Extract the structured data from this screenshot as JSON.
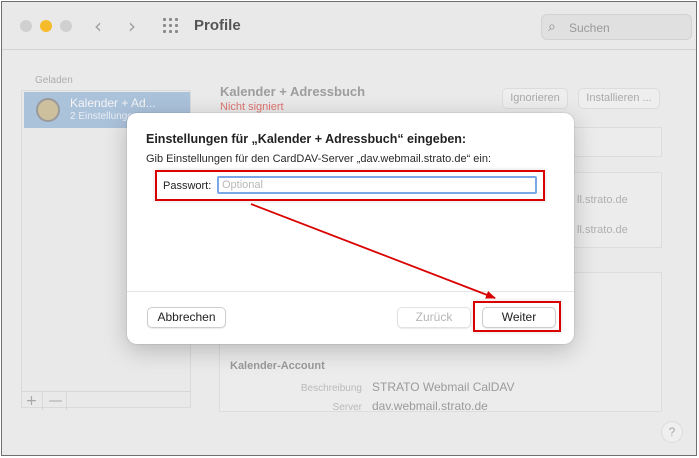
{
  "window": {
    "title": "Profile",
    "search_placeholder": "Suchen"
  },
  "sidebar": {
    "section_label": "Geladen",
    "items": [
      {
        "name": "Kalender + Ad...",
        "subtitle": "2 Einstellungen"
      }
    ],
    "add_label": "+",
    "remove_label": "—"
  },
  "detail": {
    "title": "Kalender + Adressbuch",
    "status": "Nicht signiert",
    "status_color": "#e05a55",
    "ignore_button": "Ignorieren",
    "install_button": "Installieren ...",
    "partial_lines": [
      "ll.strato.de",
      "ll.strato.de"
    ],
    "section_heading": "Kalender-Account",
    "fields": [
      {
        "label": "Beschreibung",
        "value": "STRATO Webmail CalDAV"
      },
      {
        "label": "Server",
        "value": "dav.webmail.strato.de"
      }
    ]
  },
  "dialog": {
    "title": "Einstellungen für „Kalender + Adressbuch“ eingeben:",
    "message": "Gib Einstellungen für den CardDAV-Server „dav.webmail.strato.de“ ein:",
    "password_label": "Passwort:",
    "password_placeholder": "Optional",
    "cancel_button": "Abbrechen",
    "back_button": "Zurück",
    "next_button": "Weiter"
  },
  "help_label": "?",
  "colors": {
    "annotation": "#d90000",
    "selection": "#9fbcdb",
    "focus_ring": "#7aa7e6",
    "traffic_light_minimize": "#f5bb2b"
  },
  "icons": {
    "back": "chevron-left-icon",
    "forward": "chevron-right-icon",
    "grid": "grid-icon",
    "search": "magnifier-icon",
    "profile": "profile-badge-icon"
  }
}
